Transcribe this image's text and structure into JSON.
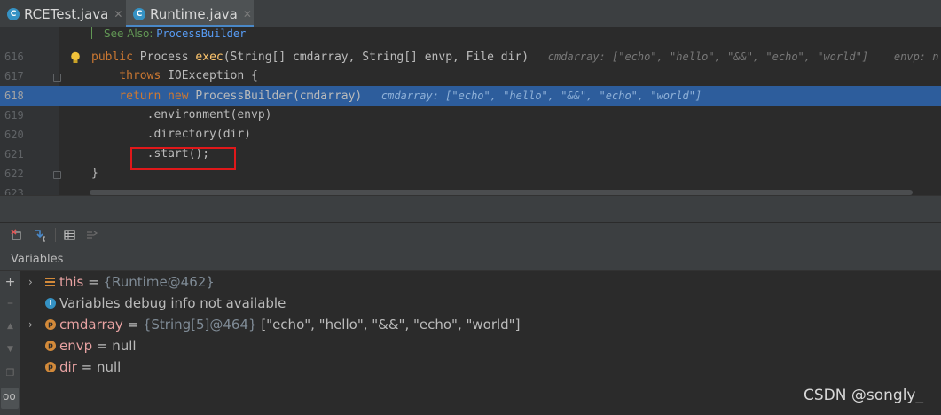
{
  "tabs": [
    {
      "label": "RCETest.java",
      "icon": "java-class-icon",
      "active": false
    },
    {
      "label": "Runtime.java",
      "icon": "java-class-icon",
      "active": true
    }
  ],
  "editor": {
    "see_also_label": "See Also: ",
    "see_also_link": "ProcessBuilder",
    "lines": [
      {
        "num": "616",
        "parts": [
          {
            "t": "public ",
            "c": "kw"
          },
          {
            "t": "Process ",
            "c": ""
          },
          {
            "t": "exec",
            "c": "fn"
          },
          {
            "t": "(String[] cmdarray, String[] envp, File dir)",
            "c": ""
          },
          {
            "t": "   cmdarray: [\"echo\", \"hello\", \"&&\", \"echo\", \"world\"]    envp: n",
            "c": "hint"
          }
        ]
      },
      {
        "num": "617",
        "parts": [
          {
            "t": "    throws ",
            "c": "kw"
          },
          {
            "t": "IOException {",
            "c": ""
          }
        ]
      },
      {
        "num": "618",
        "parts": [
          {
            "t": "    return new ",
            "c": "kw"
          },
          {
            "t": "ProcessBuilder(cmdarray)",
            "c": ""
          },
          {
            "t": "   cmdarray: [\"echo\", \"hello\", \"&&\", \"echo\", \"world\"]",
            "c": "hint"
          }
        ]
      },
      {
        "num": "619",
        "parts": [
          {
            "t": "        .environment(envp)",
            "c": ""
          }
        ]
      },
      {
        "num": "620",
        "parts": [
          {
            "t": "        .directory(dir)",
            "c": ""
          }
        ]
      },
      {
        "num": "621",
        "parts": [
          {
            "t": "        .start();",
            "c": ""
          }
        ]
      },
      {
        "num": "622",
        "parts": [
          {
            "t": "}",
            "c": ""
          }
        ]
      },
      {
        "num": "623",
        "parts": []
      }
    ]
  },
  "variables": {
    "header": "Variables",
    "rows": [
      {
        "expand": "›",
        "icon": "fields-list-icon",
        "name": "this",
        "sep": " = ",
        "ref": "{Runtime@462}",
        "value": ""
      },
      {
        "expand": "",
        "icon": "info-icon",
        "name": "",
        "sep": "",
        "ref": "",
        "value": "Variables debug info not available"
      },
      {
        "expand": "›",
        "icon": "parameter-icon",
        "name": "cmdarray",
        "sep": " = ",
        "ref": "{String[5]@464}",
        "value": " [\"echo\", \"hello\", \"&&\", \"echo\", \"world\"]"
      },
      {
        "expand": "",
        "icon": "parameter-icon",
        "name": "envp",
        "sep": " = ",
        "ref": "",
        "value": "null"
      },
      {
        "expand": "",
        "icon": "parameter-icon",
        "name": "dir",
        "sep": " = ",
        "ref": "",
        "value": "null"
      }
    ]
  },
  "watermark": "CSDN @songly_",
  "colors": {
    "highlight": "#2d5d9c",
    "keyword": "#cc7832",
    "method": "#ffc66d",
    "annotation_box": "#e0181a"
  }
}
